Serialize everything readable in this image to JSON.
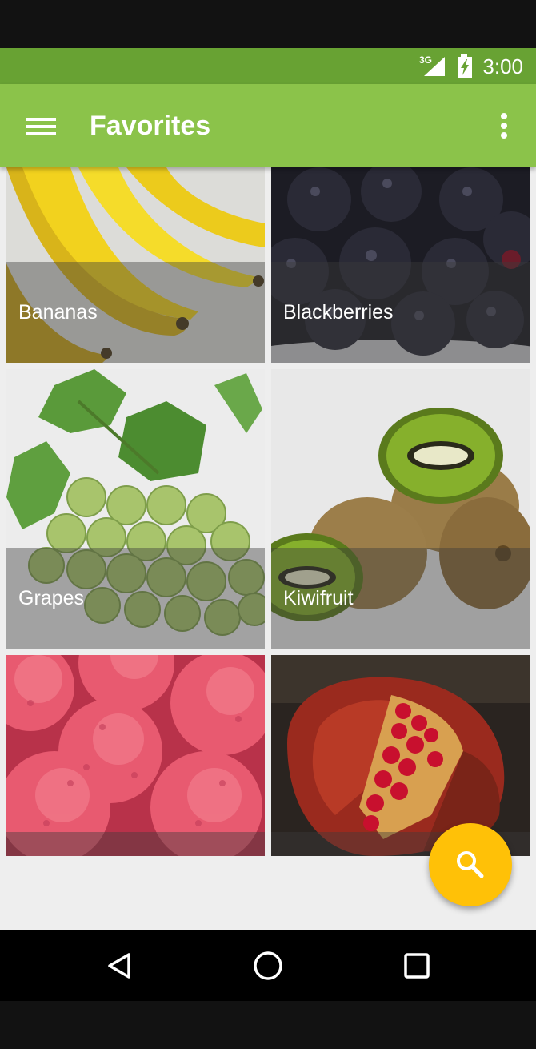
{
  "status_bar": {
    "network_type": "3G",
    "time": "3:00",
    "icons": [
      "signal-icon",
      "battery-charging-icon"
    ]
  },
  "app_bar": {
    "title": "Favorites",
    "menu_icon": "hamburger-menu-icon",
    "overflow_icon": "more-vert-icon"
  },
  "tiles": [
    {
      "label": "Bananas"
    },
    {
      "label": "Blackberries"
    },
    {
      "label": "Grapes"
    },
    {
      "label": "Kiwifruit"
    },
    {
      "label": ""
    },
    {
      "label": ""
    }
  ],
  "fab": {
    "icon": "search-icon"
  },
  "nav_bar": {
    "icons": [
      "back-icon",
      "home-icon",
      "recents-icon"
    ]
  },
  "colors": {
    "status_bar": "#68a233",
    "app_bar": "#8bc34a",
    "fab": "#ffc107",
    "background": "#eeeeee"
  }
}
